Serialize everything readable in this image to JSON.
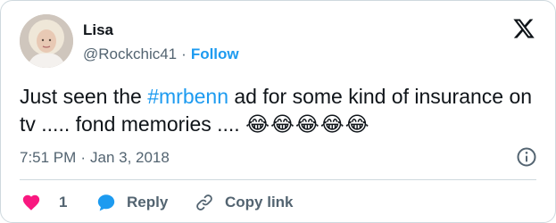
{
  "author": {
    "name": "Lisa",
    "handle": "@Rockchic41",
    "separator": "·",
    "follow_label": "Follow"
  },
  "tweet": {
    "text_before": "Just seen the ",
    "hashtag": "#mrbenn",
    "text_after": " ad for some kind of insurance on tv ..... fond memories .... ",
    "emojis": "😂😂😂😂😂"
  },
  "meta": {
    "time": "7:51 PM",
    "separator": "·",
    "date": "Jan 3, 2018"
  },
  "actions": {
    "like_count": "1",
    "reply_label": "Reply",
    "copy_label": "Copy link"
  },
  "colors": {
    "accent": "#1d9bf0",
    "like": "#f91880",
    "secondary_text": "#536471"
  },
  "icons": {
    "logo": "x-logo-icon",
    "info": "info-icon",
    "like": "heart-icon",
    "reply": "reply-bubble-icon",
    "copy": "link-icon"
  }
}
